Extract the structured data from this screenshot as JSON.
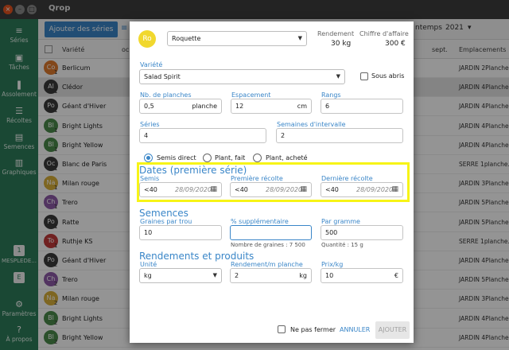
{
  "window": {
    "title": "Qrop",
    "close_glyph": "×",
    "min_glyph": "–",
    "max_glyph": "□"
  },
  "nav": {
    "items": [
      {
        "icon": "menu-icon",
        "glyph": "≡",
        "label": "Séries"
      },
      {
        "icon": "calendar-check-icon",
        "glyph": "▣",
        "label": "Tâches"
      },
      {
        "icon": "book-icon",
        "glyph": "❚",
        "label": "Assolement"
      },
      {
        "icon": "list-icon",
        "glyph": "☰",
        "label": "Récoltes"
      },
      {
        "icon": "seeds-icon",
        "glyph": "▤",
        "label": "Semences"
      },
      {
        "icon": "chart-icon",
        "glyph": "▥",
        "label": "Graphiques"
      }
    ],
    "year_badge": "1",
    "year_label": "MESPLEDE...",
    "second_badge": "E",
    "settings": {
      "glyph": "⚙",
      "label": "Paramètres"
    },
    "about": {
      "glyph": "?",
      "label": "À propos"
    }
  },
  "toolbar": {
    "add_series": "Ajouter des séries",
    "right_label": "ntemps",
    "year": "2021"
  },
  "table": {
    "headers": {
      "variete": "Variété",
      "oc": "oc",
      "sept": "sept.",
      "emplacements": "Emplacements"
    },
    "rows": [
      {
        "initials": "Co",
        "num": "1",
        "color": "#e07a2d",
        "name": "Berlicum",
        "location": "JARDIN 2Planche..."
      },
      {
        "initials": "Al",
        "num": "1",
        "color": "#3c3c3c",
        "name": "Clédor",
        "location": "JARDIN 4Planche..."
      },
      {
        "initials": "Po",
        "num": "1",
        "color": "#3c3c3c",
        "name": "Géant d'Hiver",
        "location": "JARDIN 4Planche..."
      },
      {
        "initials": "Bl",
        "num": "1",
        "color": "#4a8a4a",
        "name": "Bright Lights",
        "location": "JARDIN 4Planche..."
      },
      {
        "initials": "Bl",
        "num": "1",
        "color": "#4a8a4a",
        "name": "Bright Yellow",
        "location": "JARDIN 4Planche..."
      },
      {
        "initials": "Oc",
        "num": "1",
        "color": "#3c3c3c",
        "name": "Blanc de Paris",
        "location": "SERRE 1planche..."
      },
      {
        "initials": "Na",
        "num": "1",
        "color": "#d9b03a",
        "name": "Milan rouge",
        "location": "JARDIN 3Planche..."
      },
      {
        "initials": "Ch",
        "num": "1",
        "color": "#8e5aa8",
        "name": "Trero",
        "location": "JARDIN 5Planche..."
      },
      {
        "initials": "Po",
        "num": "1",
        "color": "#3c3c3c",
        "name": "Ratte",
        "location": "JARDIN 5Planche..."
      },
      {
        "initials": "To",
        "num": "1",
        "color": "#c23a3a",
        "name": "Ruthje KS",
        "location": "SERRE 1planche..."
      },
      {
        "initials": "Po",
        "num": "2",
        "color": "#3c3c3c",
        "name": "Géant d'Hiver",
        "location": "JARDIN 4Planche..."
      },
      {
        "initials": "Ch",
        "num": "2",
        "color": "#8e5aa8",
        "name": "Trero",
        "location": "JARDIN 5Planche..."
      },
      {
        "initials": "Na",
        "num": "2",
        "color": "#d9b03a",
        "name": "Milan rouge",
        "location": "JARDIN 3Planche..."
      },
      {
        "initials": "Bl",
        "num": "2",
        "color": "#4a8a4a",
        "name": "Bright Lights",
        "location": "JARDIN 4Planche..."
      },
      {
        "initials": "Bl",
        "num": "2",
        "color": "#4a8a4a",
        "name": "Bright Yellow",
        "location": "JARDIN 4Planche..."
      }
    ]
  },
  "dialog": {
    "crop_initials": "Ro",
    "crop_value": "Roquette",
    "rendement_label": "Rendement",
    "rendement_value": "30 kg",
    "ca_label": "Chiffre d'affaire",
    "ca_value": "300 €",
    "variete_label": "Variété",
    "variete_value": "Salad Spirit",
    "sous_abris": "Sous abris",
    "nb_planches_label": "Nb. de planches",
    "nb_planches_value": "0,5",
    "nb_planches_suffix": "planche",
    "espacement_label": "Espacement",
    "espacement_value": "12",
    "espacement_suffix": "cm",
    "rangs_label": "Rangs",
    "rangs_value": "6",
    "series_label": "Séries",
    "series_value": "4",
    "semaines_label": "Semaines d'intervalle",
    "semaines_value": "2",
    "radio_semis_direct": "Semis direct",
    "radio_plant_fait": "Plant, fait",
    "radio_plant_achete": "Plant, acheté",
    "dates_title": "Dates (première série)",
    "semis_label": "Semis",
    "premiere_recolte_label": "Première récolte",
    "derniere_recolte_label": "Dernière récolte",
    "date_value": "<40",
    "date_placeholder": "28/09/2020",
    "semences_title": "Semences",
    "graines_label": "Graines par trou",
    "graines_value": "10",
    "supp_label": "% supplémentaire",
    "supp_value": "",
    "nb_graines_hint": "Nombre de graines : 7 500",
    "par_gramme_label": "Par gramme",
    "par_gramme_value": "500",
    "quantite_hint": "Quantité : 15 g",
    "rendements_title": "Rendements et produits",
    "unite_label": "Unité",
    "unite_value": "kg",
    "rendement_planche_label": "Rendement/m planche",
    "rendement_planche_value": "2",
    "rendement_planche_suffix": "kg",
    "prix_label": "Prix/kg",
    "prix_value": "10",
    "prix_suffix": "€",
    "ne_pas_fermer": "Ne pas fermer",
    "annuler": "ANNULER",
    "ajouter": "AJOUTER"
  },
  "colors": {
    "accent": "#3a86c8",
    "nav": "#2e7d5a",
    "highlight": "#f7f417"
  }
}
